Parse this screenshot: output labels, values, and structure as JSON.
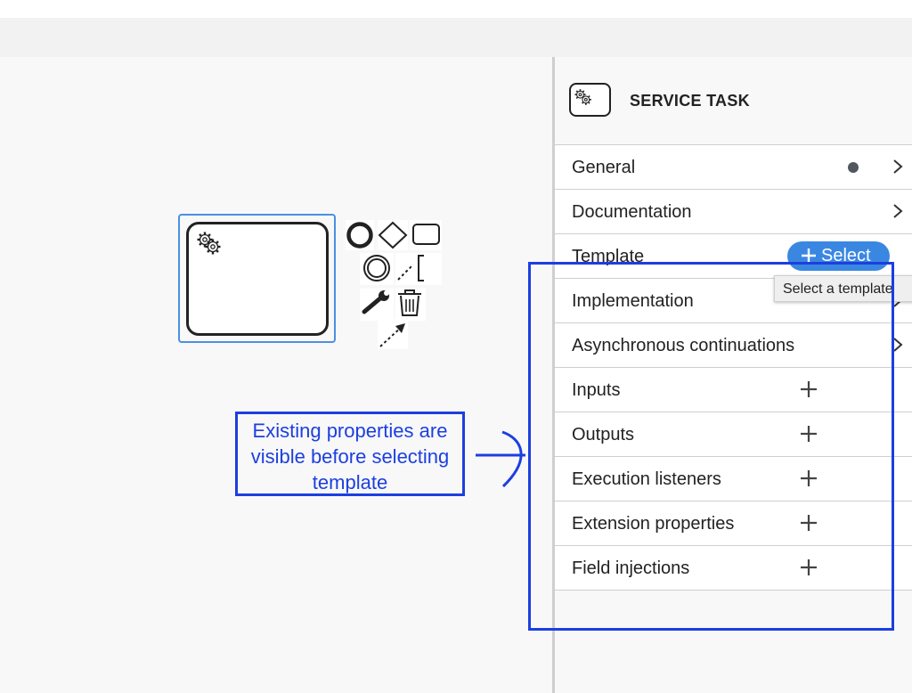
{
  "panel": {
    "title": "SERVICE TASK",
    "header_icon": "gear-icon",
    "groups": [
      {
        "label": "General",
        "indicator": "dot",
        "action": "chevron"
      },
      {
        "label": "Documentation",
        "action": "chevron"
      },
      {
        "label": "Template",
        "action": "select-button"
      },
      {
        "label": "Implementation",
        "action": "chevron"
      },
      {
        "label": "Asynchronous continuations",
        "action": "chevron"
      },
      {
        "label": "Inputs",
        "action": "plus"
      },
      {
        "label": "Outputs",
        "action": "plus"
      },
      {
        "label": "Execution listeners",
        "action": "plus"
      },
      {
        "label": "Extension properties",
        "action": "plus"
      },
      {
        "label": "Field injections",
        "action": "plus"
      }
    ],
    "select_button_label": "Select",
    "tooltip": "Select a template"
  },
  "annotation": {
    "lines": [
      "Existing properties are",
      "visible before selecting",
      "template"
    ]
  },
  "colors": {
    "accent": "#3a87e2",
    "annotation": "#1c3fe0",
    "selection": "#4a90e2",
    "indicator_dot": "#52565e"
  }
}
